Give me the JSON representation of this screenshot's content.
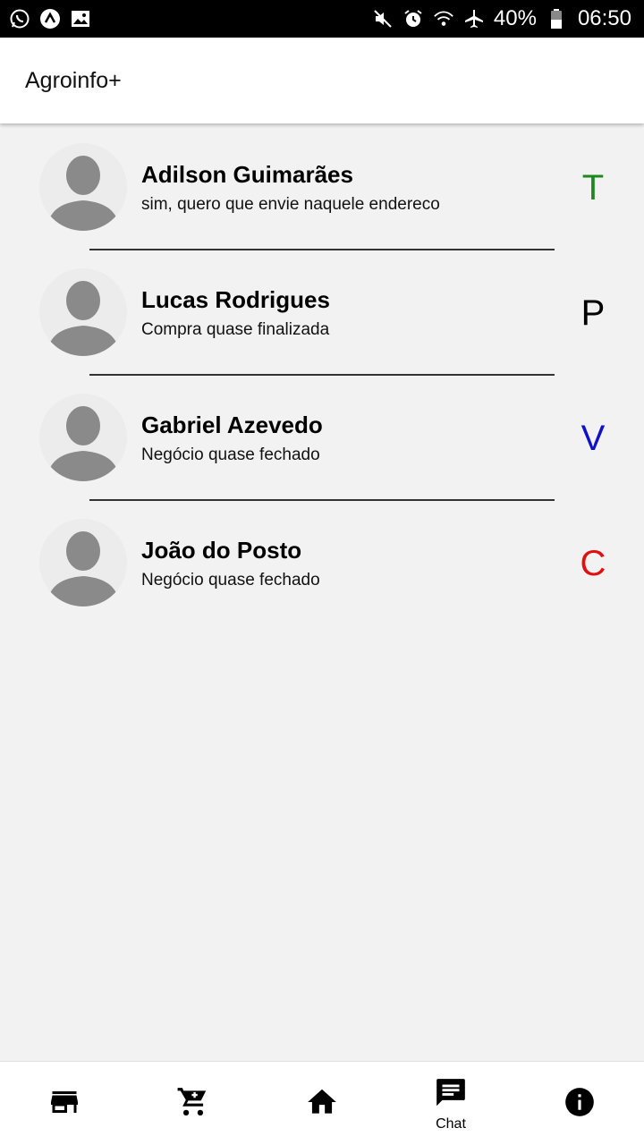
{
  "status_bar": {
    "battery": "40%",
    "time": "06:50"
  },
  "app_bar": {
    "title": "Agroinfo+"
  },
  "chats": [
    {
      "name": "Adilson Guimarães",
      "message": "sim, quero que envie naquele endereco",
      "tag": "T",
      "tag_color": "#1a8a1a"
    },
    {
      "name": "Lucas Rodrigues",
      "message": "Compra quase finalizada",
      "tag": "P",
      "tag_color": "#000000"
    },
    {
      "name": "Gabriel Azevedo",
      "message": "Negócio quase fechado",
      "tag": "V",
      "tag_color": "#1010cc"
    },
    {
      "name": "João do Posto",
      "message": "Negócio quase fechado",
      "tag": "C",
      "tag_color": "#dd1111"
    }
  ],
  "bottom_nav": {
    "items": [
      {
        "icon": "store-icon"
      },
      {
        "icon": "cart-icon"
      },
      {
        "icon": "home-icon"
      },
      {
        "icon": "chat-icon",
        "label": "Chat"
      },
      {
        "icon": "info-icon"
      }
    ]
  }
}
